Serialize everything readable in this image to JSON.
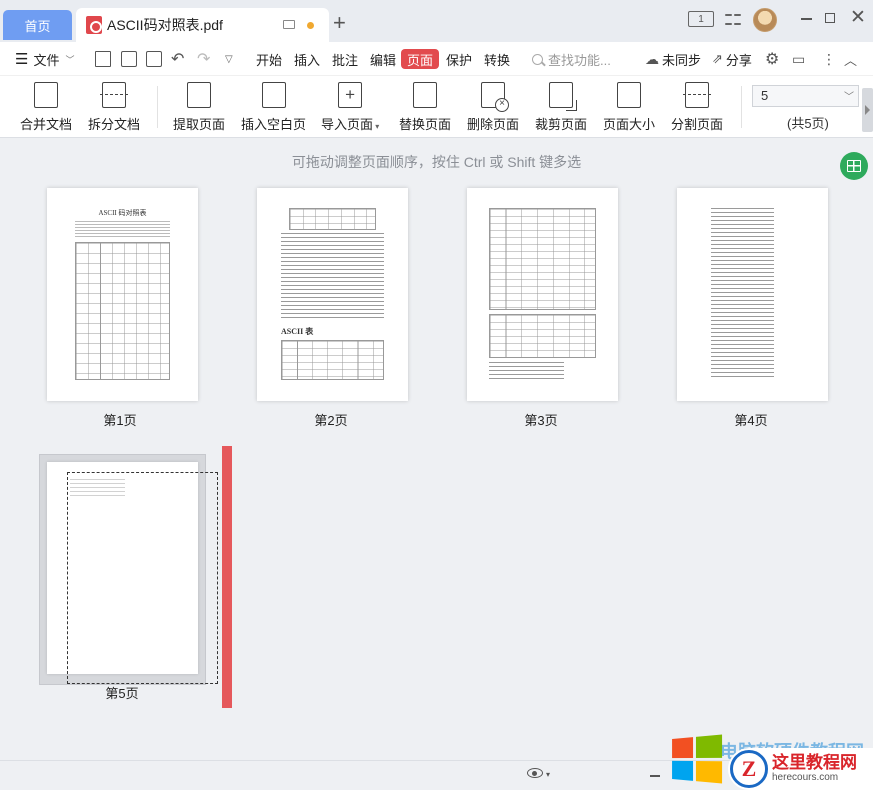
{
  "titlebar": {
    "home_tab": "首页",
    "doc_tab": "ASCII码对照表.pdf",
    "layout_badge": "1"
  },
  "menu": {
    "file": "文件",
    "tabs": [
      "开始",
      "插入",
      "批注",
      "编辑",
      "页面",
      "保护",
      "转换"
    ],
    "search_placeholder": "查找功能...",
    "sync": "未同步",
    "share": "分享"
  },
  "ribbon": {
    "buttons": [
      "合并文档",
      "拆分文档",
      "提取页面",
      "插入空白页",
      "导入页面",
      "替换页面",
      "删除页面",
      "裁剪页面",
      "页面大小",
      "分割页面"
    ],
    "page_value": "5",
    "page_total": "(共5页)"
  },
  "content": {
    "hint": "可拖动调整页面顺序，按住 Ctrl 或 Shift 键多选",
    "pages": [
      {
        "label": "第1页",
        "title": "ASCII 码对照表"
      },
      {
        "label": "第2页",
        "title": "ASCII 表"
      },
      {
        "label": "第3页"
      },
      {
        "label": "第4页"
      },
      {
        "label": "第5页"
      }
    ]
  },
  "watermark": {
    "cn_blue": "电脑软硬件教程网",
    "cn_red": "这里教程网",
    "url": "herecours.com",
    "badge_letter": "Z"
  }
}
